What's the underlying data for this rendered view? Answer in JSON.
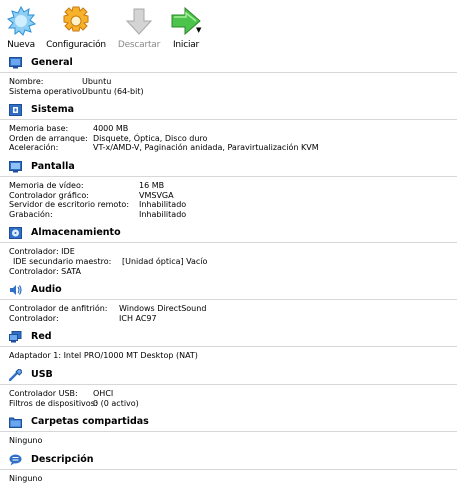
{
  "toolbar": {
    "new_label": "Nueva",
    "settings_label": "Configuración",
    "discard_label": "Descartar",
    "start_label": "Iniciar"
  },
  "sections": {
    "general": {
      "title": "General",
      "rows": [
        {
          "key": "Nombre:",
          "value": "Ubuntu"
        },
        {
          "key": "Sistema operativo:",
          "value": "Ubuntu (64-bit)"
        }
      ]
    },
    "system": {
      "title": "Sistema",
      "rows": [
        {
          "key": "Memoria base:",
          "value": "4000 MB"
        },
        {
          "key": "Orden de arranque:",
          "value": "Disquete, Óptica, Disco duro"
        },
        {
          "key": "Aceleración:",
          "value": "VT-x/AMD-V, Paginación anidada, Paravirtualización KVM"
        }
      ]
    },
    "display": {
      "title": "Pantalla",
      "rows": [
        {
          "key": "Memoria de vídeo:",
          "value": "16 MB"
        },
        {
          "key": "Controlador gráfico:",
          "value": "VMSVGA"
        },
        {
          "key": "Servidor de escritorio remoto:",
          "value": "Inhabilitado"
        },
        {
          "key": "Grabación:",
          "value": "Inhabilitado"
        }
      ]
    },
    "storage": {
      "title": "Almacenamiento",
      "rows": [
        {
          "text": "Controlador: IDE"
        },
        {
          "key": "IDE secundario maestro:",
          "value": "[Unidad óptica] Vacío"
        },
        {
          "text": "Controlador: SATA"
        }
      ]
    },
    "audio": {
      "title": "Audio",
      "rows": [
        {
          "key": "Controlador de anfitrión:",
          "value": "Windows DirectSound"
        },
        {
          "key": "Controlador:",
          "value": "ICH AC97"
        }
      ]
    },
    "network": {
      "title": "Red",
      "rows": [
        {
          "text": "Adaptador 1:  Intel PRO/1000 MT Desktop (NAT)"
        }
      ]
    },
    "usb": {
      "title": "USB",
      "rows": [
        {
          "key": "Controlador USB:",
          "value": "OHCI"
        },
        {
          "key": "Filtros de dispositivos:",
          "value": "0 (0 activo)"
        }
      ]
    },
    "shared_folders": {
      "title": "Carpetas compartidas",
      "rows": [
        {
          "text": "Ninguno"
        }
      ]
    },
    "description": {
      "title": "Descripción",
      "rows": [
        {
          "text": "Ninguno"
        }
      ]
    }
  },
  "icons": {
    "new": "new-vm-icon",
    "settings": "settings-gear-icon",
    "discard": "discard-arrow-icon",
    "start": "start-arrow-icon",
    "general": "general-monitor-icon",
    "system": "system-chip-icon",
    "display": "display-monitor-icon",
    "storage": "storage-disk-icon",
    "audio": "audio-speaker-icon",
    "network": "network-icon",
    "usb": "usb-icon",
    "shared_folders": "shared-folder-icon",
    "description": "description-speech-icon"
  },
  "colors": {
    "accent_blue": "#2f6fc7",
    "start_green": "#3cb43c",
    "settings_orange": "#f0a020",
    "disabled_gray": "#8a8a8a"
  }
}
